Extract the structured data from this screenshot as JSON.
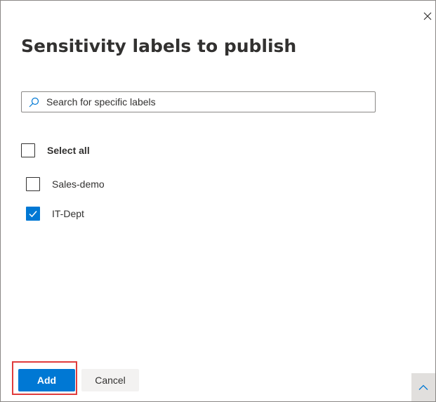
{
  "dialog": {
    "title": "Sensitivity labels to publish",
    "close_icon": "close-icon"
  },
  "search": {
    "placeholder": "Search for specific labels",
    "value": "",
    "icon": "search-icon"
  },
  "select_all": {
    "label": "Select all",
    "checked": false
  },
  "labels": [
    {
      "label": "Sales-demo",
      "checked": false
    },
    {
      "label": "IT-Dept",
      "checked": true
    }
  ],
  "footer": {
    "add_label": "Add",
    "cancel_label": "Cancel",
    "scroll_top_icon": "chevron-up-icon"
  },
  "colors": {
    "accent": "#0078d4",
    "highlight": "#e03c3c",
    "text": "#323130"
  }
}
